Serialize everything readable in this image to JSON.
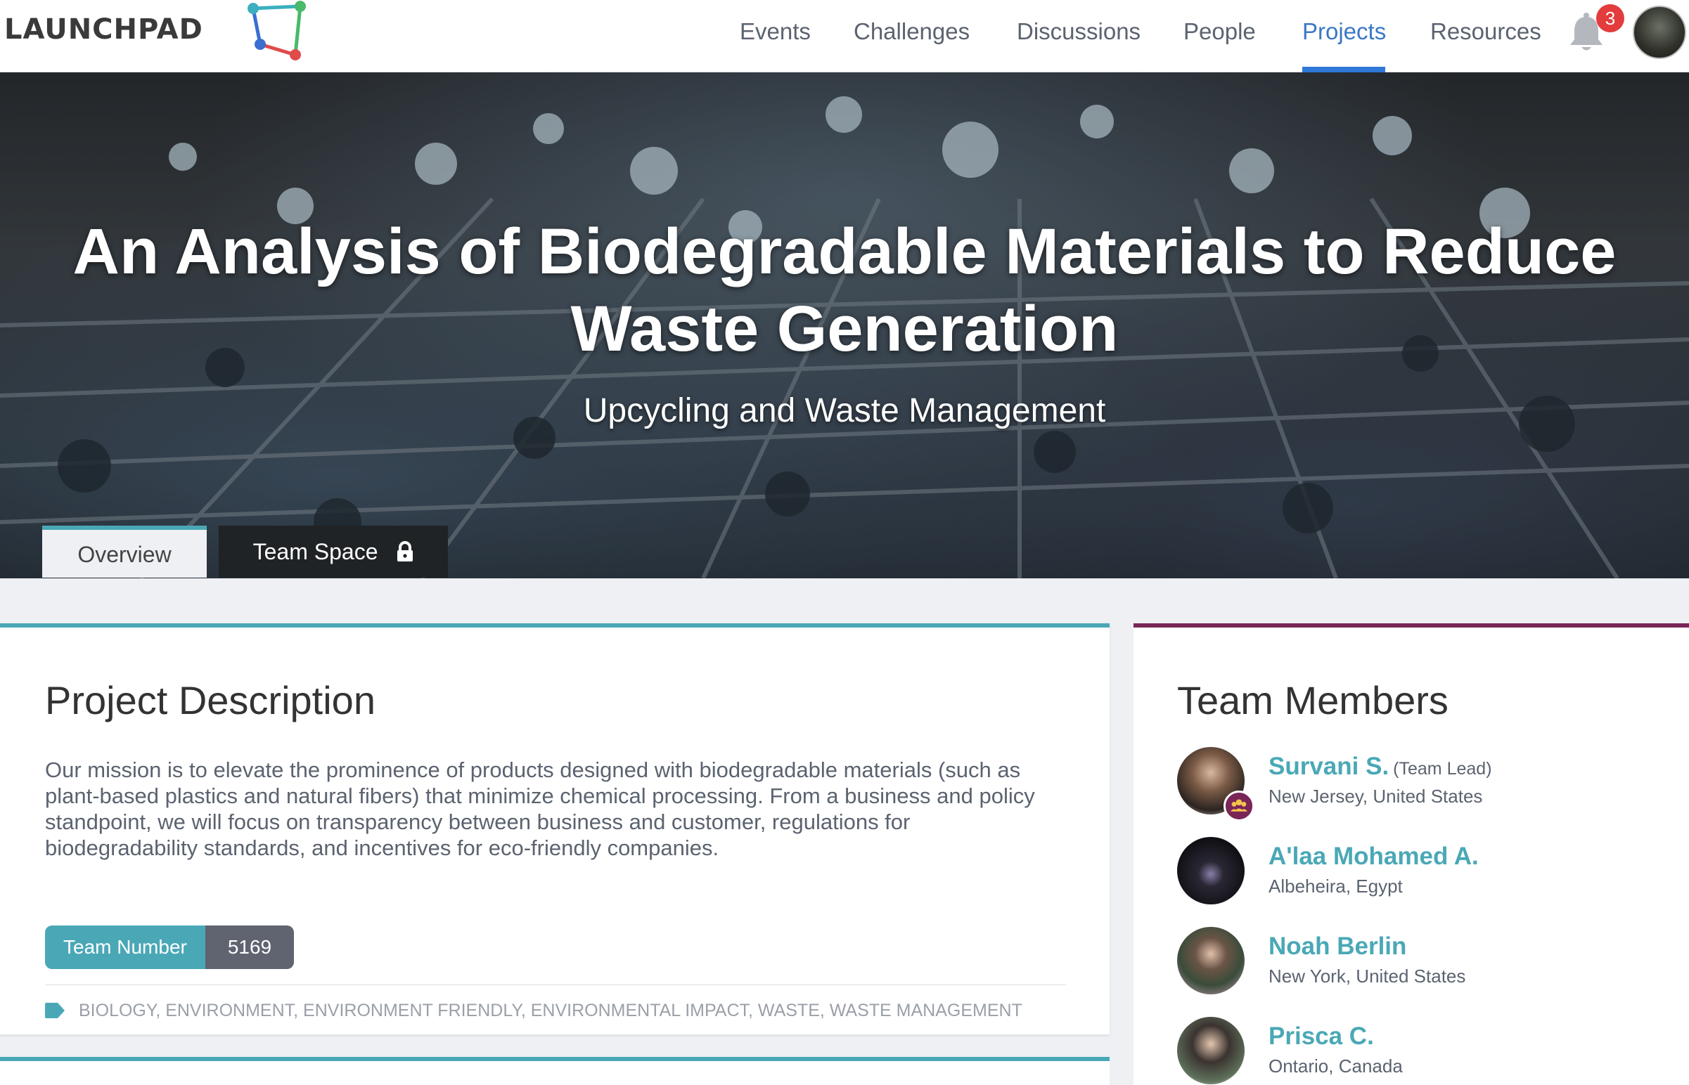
{
  "brand": "LAUNCHPAD",
  "nav": {
    "items": [
      "Events",
      "Challenges",
      "Discussions",
      "People",
      "Projects",
      "Resources"
    ],
    "active": "Projects",
    "notification_count": "3"
  },
  "hero": {
    "title": "An Analysis of Biodegradable Materials to Reduce Waste Generation",
    "subtitle": "Upcycling and Waste Management",
    "tabs": {
      "overview": "Overview",
      "team_space": "Team Space"
    }
  },
  "project": {
    "heading": "Project Description",
    "description": "Our mission is to elevate the prominence of products designed with biodegradable materials (such as plant-based plastics and natural fibers) that minimize chemical processing. From a business and policy standpoint, we will focus on transparency between business and customer, regulations for biodegradability standards, and incentives for eco-friendly companies.",
    "team_number_label": "Team Number",
    "team_number": "5169",
    "tags": "BIOLOGY, ENVIRONMENT, ENVIRONMENT FRIENDLY, ENVIRONMENTAL IMPACT, WASTE, WASTE MANAGEMENT"
  },
  "team": {
    "heading": "Team Members",
    "members": [
      {
        "name": "Survani S.",
        "role": "(Team Lead)",
        "location": "New Jersey, United States"
      },
      {
        "name": "A'laa Mohamed A.",
        "role": "",
        "location": "Albeheira, Egypt"
      },
      {
        "name": "Noah Berlin",
        "role": "",
        "location": "New York, United States"
      },
      {
        "name": "Prisca C.",
        "role": "",
        "location": "Ontario, Canada"
      }
    ]
  },
  "colors": {
    "accent_teal": "#4aa8b6",
    "accent_purple": "#7a2558",
    "nav_active": "#2f78d8",
    "badge": "#e33c3c"
  },
  "icons": [
    "logo-mark-icon",
    "bell-icon",
    "lock-icon",
    "tag-icon",
    "team-lead-icon"
  ]
}
